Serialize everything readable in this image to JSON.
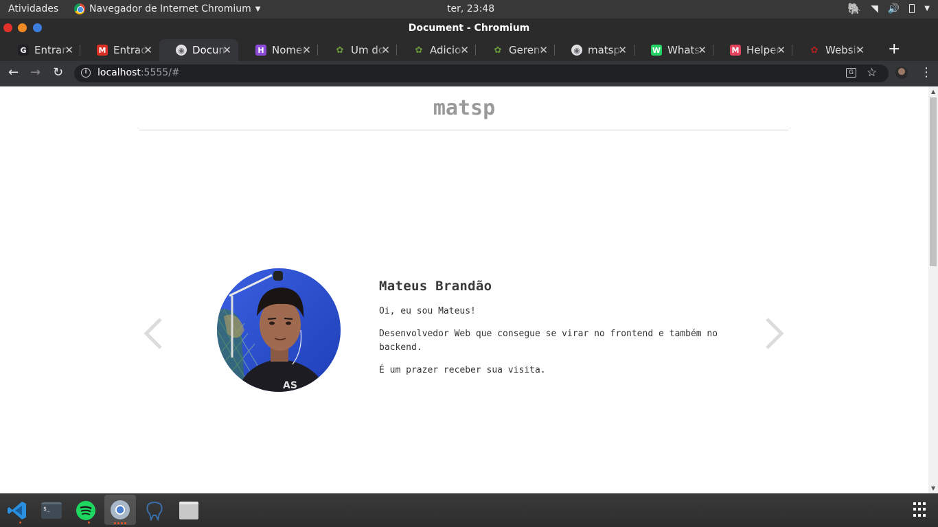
{
  "topbar": {
    "activities": "Atividades",
    "app_name": "Navegador de Internet Chromium",
    "clock": "ter, 23:48"
  },
  "window": {
    "title": "Document - Chromium"
  },
  "tabs": [
    {
      "label": "Entrar",
      "favicon": "G",
      "color": "#202124"
    },
    {
      "label": "Entrada",
      "favicon": "M",
      "color": "#d93025"
    },
    {
      "label": "Document",
      "favicon": "globe",
      "color": "#5f6368"
    },
    {
      "label": "Nomes",
      "favicon": "H",
      "color": "#8a4bd6"
    },
    {
      "label": "Um dono",
      "favicon": "bug",
      "color": "#6a9a3a"
    },
    {
      "label": "Adicionar",
      "favicon": "bug",
      "color": "#6a9a3a"
    },
    {
      "label": "Gerenciar",
      "favicon": "bug",
      "color": "#6a9a3a"
    },
    {
      "label": "matsp.com",
      "favicon": "globe",
      "color": "#5f6368"
    },
    {
      "label": "WhatsApp",
      "favicon": "W",
      "color": "#25d366"
    },
    {
      "label": "Helpers",
      "favicon": "M",
      "color": "#e0445c"
    },
    {
      "label": "Website",
      "favicon": "bug",
      "color": "#b02020"
    }
  ],
  "toolbar": {
    "url_host": "localhost",
    "url_rest": ":5555/#"
  },
  "page": {
    "site_title": "matsp",
    "name": "Mateus Brandão",
    "greeting": "Oi, eu sou Mateus!",
    "description": "Desenvolvedor Web que consegue se virar no frontend e também no backend.",
    "welcome": "É um prazer receber sua visita."
  },
  "dock": [
    "vscode-icon",
    "terminal-icon",
    "spotify-icon",
    "chromium-icon",
    "pgadmin-icon",
    "files-icon"
  ]
}
